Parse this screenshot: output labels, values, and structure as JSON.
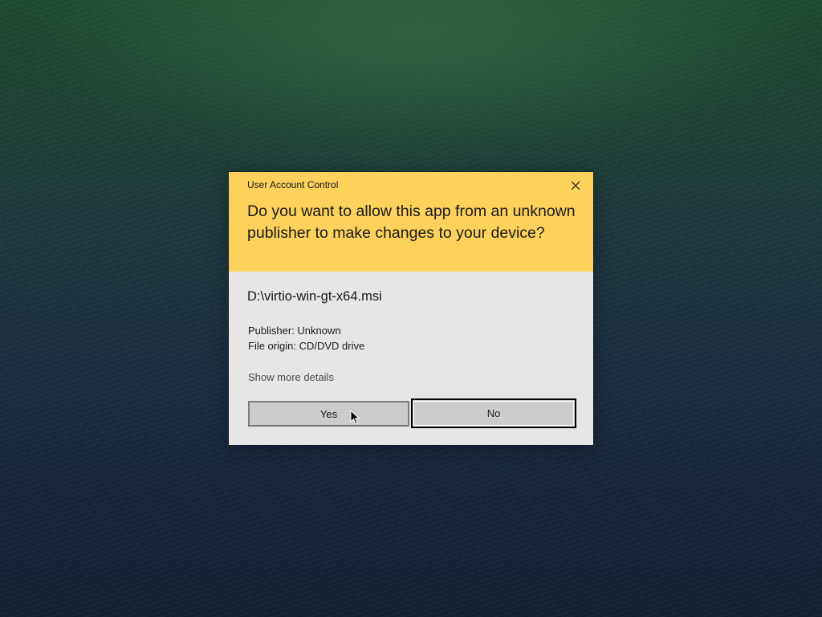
{
  "dialog": {
    "title": "User Account Control",
    "question": "Do you want to allow this app from an unknown publisher to make changes to your device?",
    "app_name": "D:\\virtio-win-gt-x64.msi",
    "publisher": "Publisher: Unknown",
    "file_origin": "File origin: CD/DVD drive",
    "details_link": "Show more details",
    "yes_label": "Yes",
    "no_label": "No",
    "close_icon": "close-icon"
  },
  "colors": {
    "header_bg": "#fcd15c",
    "body_bg": "#e6e6e6",
    "button_bg": "#cccccc"
  }
}
